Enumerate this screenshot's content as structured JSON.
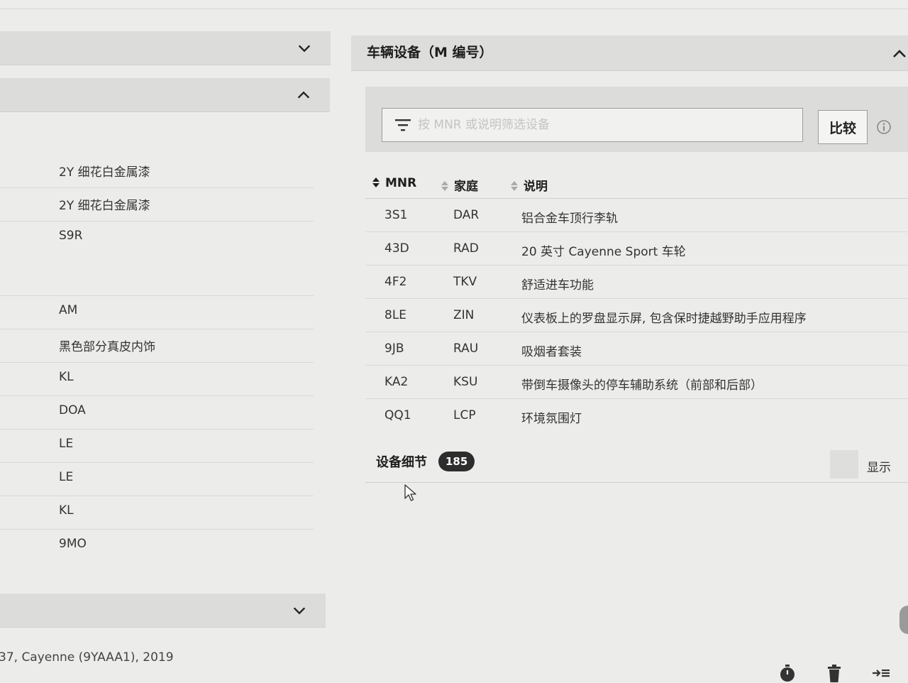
{
  "right_panel": {
    "title": "车辆设备（M 编号）",
    "filter": {
      "placeholder": "按 MNR 或说明筛选设备"
    },
    "compare_label": "比较",
    "table": {
      "headers": {
        "mnr": "MNR",
        "family": "家庭",
        "description": "说明"
      },
      "rows": [
        {
          "mnr": "3S1",
          "family": "DAR",
          "description": "铝合金车顶行李轨"
        },
        {
          "mnr": "43D",
          "family": "RAD",
          "description": "20 英寸 Cayenne Sport 车轮"
        },
        {
          "mnr": "4F2",
          "family": "TKV",
          "description": "舒适进车功能"
        },
        {
          "mnr": "8LE",
          "family": "ZIN",
          "description": "仪表板上的罗盘显示屏, 包含保时捷越野助手应用程序"
        },
        {
          "mnr": "9JB",
          "family": "RAU",
          "description": "吸烟者套装"
        },
        {
          "mnr": "KA2",
          "family": "KSU",
          "description": "带倒车摄像头的停车辅助系统（前部和后部）"
        },
        {
          "mnr": "QQ1",
          "family": "LCP",
          "description": "环境氛围灯"
        }
      ]
    },
    "details": {
      "label": "设备细节",
      "count": "185",
      "show_label": "显示"
    }
  },
  "left_panel": {
    "rows": [
      "2Y 细花白金属漆",
      "2Y 细花白金属漆",
      "S9R",
      "AM",
      "黑色部分真皮内饰",
      "KL",
      "DOA",
      "LE",
      "LE",
      "KL",
      "9MO"
    ],
    "vehicle": "37, Cayenne (9YAAA1), 2019"
  },
  "icons": {
    "accordion_collapsed": "chevron-down-icon",
    "accordion_expanded": "chevron-up-icon",
    "filter": "filter-icon",
    "info": "info-icon",
    "toolbar": [
      "stopwatch-icon",
      "trash-icon",
      "collapse-panel-icon"
    ]
  }
}
